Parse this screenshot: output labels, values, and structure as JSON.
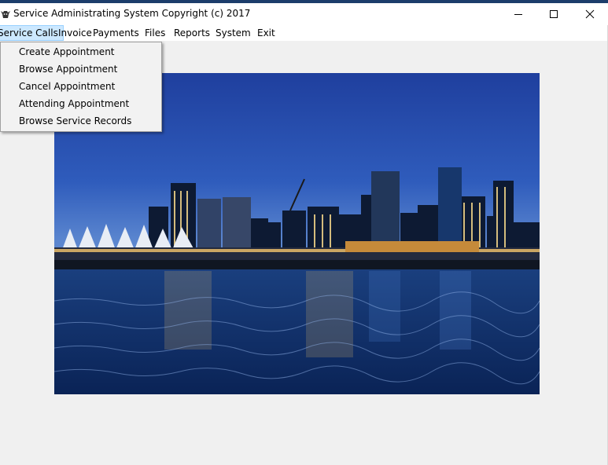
{
  "window": {
    "title": "Service Administrating System  Copyright (c) 2017",
    "controls": {
      "minimize": "minimize",
      "maximize": "maximize",
      "close": "close"
    }
  },
  "menubar": {
    "items": [
      {
        "label": "Service Calls",
        "active": true
      },
      {
        "label": "Invoice"
      },
      {
        "label": "Payments"
      },
      {
        "label": "Files"
      },
      {
        "label": "Reports"
      },
      {
        "label": "System"
      },
      {
        "label": "Exit"
      }
    ]
  },
  "dropdown": {
    "items": [
      {
        "label": "Create Appointment"
      },
      {
        "label": "Browse Appointment"
      },
      {
        "label": "Cancel Appointment"
      },
      {
        "label": "Attending Appointment"
      },
      {
        "label": "Browse Service Records"
      }
    ]
  },
  "icons": {
    "app": "bull-head-icon",
    "minimize": "minimize-icon",
    "maximize": "maximize-icon",
    "close": "close-icon"
  },
  "colors": {
    "menu_highlight": "#cce8ff",
    "sky_top": "#1f3f9e",
    "water": "#0e2e6a"
  }
}
